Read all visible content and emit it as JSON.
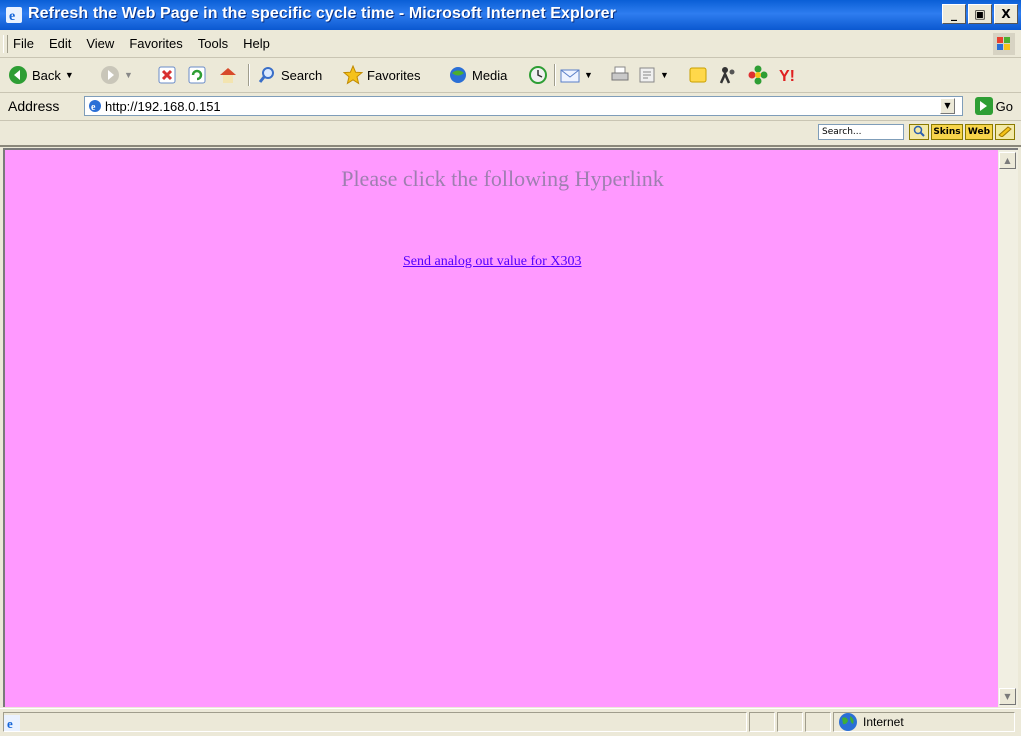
{
  "window": {
    "title": "Refresh the Web Page in the specific cycle time - Microsoft Internet Explorer",
    "minimize": "_",
    "maximize": "▣",
    "close": "X"
  },
  "menu": {
    "items": [
      "File",
      "Edit",
      "View",
      "Favorites",
      "Tools",
      "Help"
    ]
  },
  "toolbar": {
    "back_label": "Back",
    "search_label": "Search",
    "favorites_label": "Favorites",
    "media_label": "Media"
  },
  "address": {
    "label": "Address",
    "url": "http://192.168.0.151",
    "go_label": "Go"
  },
  "linkbar": {
    "search_placeholder": "Search...",
    "skins_label": "Skins",
    "web_label": "Web"
  },
  "page": {
    "heading": "Please click the following Hyperlink",
    "link_text": "Send analog out value for X303",
    "background_color": "#ff99ff",
    "heading_color": "#9e7fb0",
    "link_color": "#5400ff"
  },
  "status": {
    "zone": "Internet"
  }
}
